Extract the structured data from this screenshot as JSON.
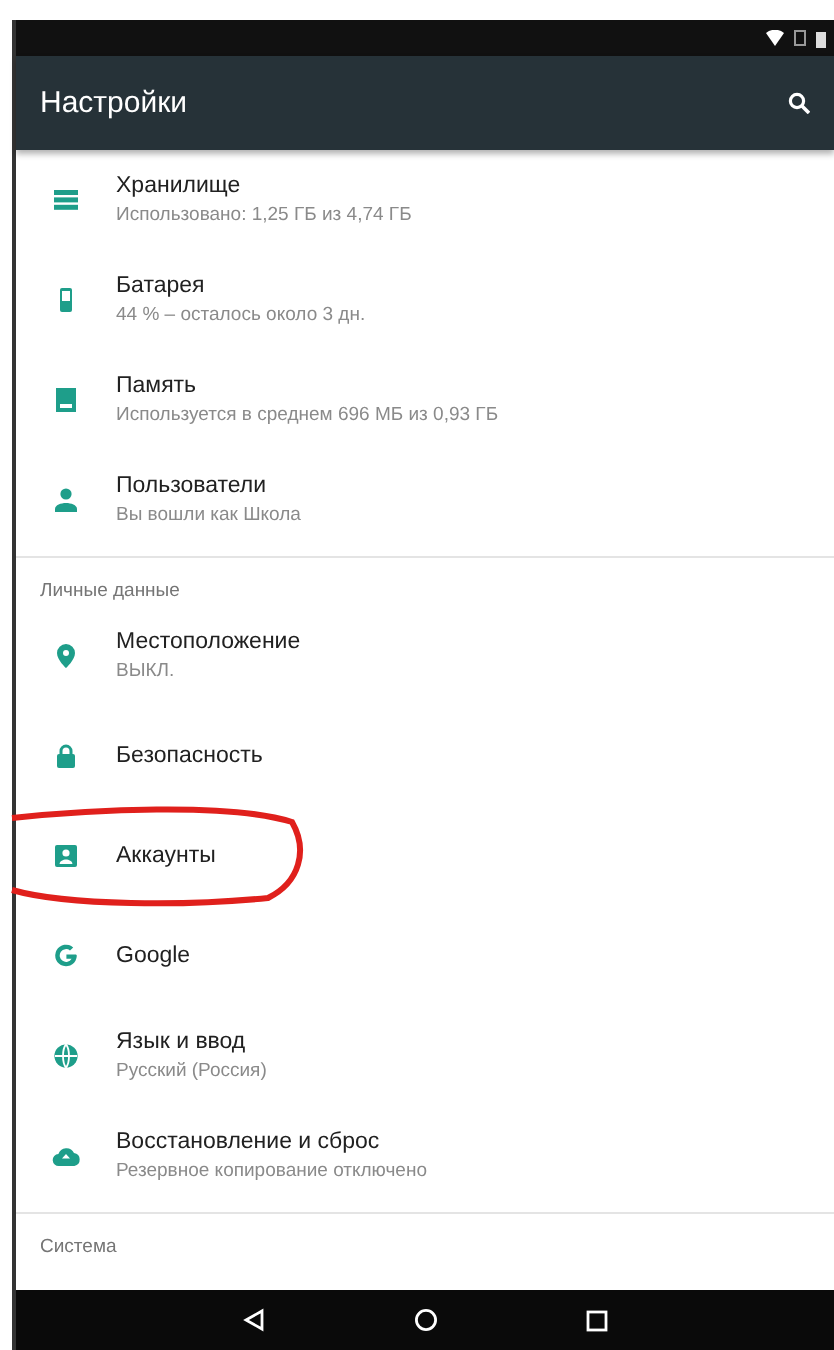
{
  "toolbar": {
    "title": "Настройки"
  },
  "sections": [
    {
      "items": [
        {
          "kind": "storage",
          "title": "Хранилище",
          "subtitle": "Использовано: 1,25 ГБ из 4,74 ГБ",
          "circled": false
        },
        {
          "kind": "battery",
          "title": "Батарея",
          "subtitle": "44 % – осталось около 3 дн.",
          "circled": false
        },
        {
          "kind": "memory",
          "title": "Память",
          "subtitle": "Используется в среднем 696 МБ из 0,93 ГБ",
          "circled": false
        },
        {
          "kind": "user",
          "title": "Пользователи",
          "subtitle": "Вы вошли как Школа",
          "circled": false
        }
      ]
    },
    {
      "header": "Личные данные",
      "items": [
        {
          "kind": "location",
          "title": "Местоположение",
          "subtitle": "ВЫКЛ.",
          "circled": false
        },
        {
          "kind": "lock",
          "title": "Безопасность",
          "circled": false
        },
        {
          "kind": "account",
          "title": "Аккаунты",
          "circled": true
        },
        {
          "kind": "google",
          "title": "Google",
          "circled": false
        },
        {
          "kind": "globe",
          "title": "Язык и ввод",
          "subtitle": "Русский (Россия)",
          "circled": false
        },
        {
          "kind": "backup",
          "title": "Восстановление и сброс",
          "subtitle": "Резервное копирование отключено",
          "circled": false
        }
      ]
    },
    {
      "header": "Система"
    }
  ]
}
